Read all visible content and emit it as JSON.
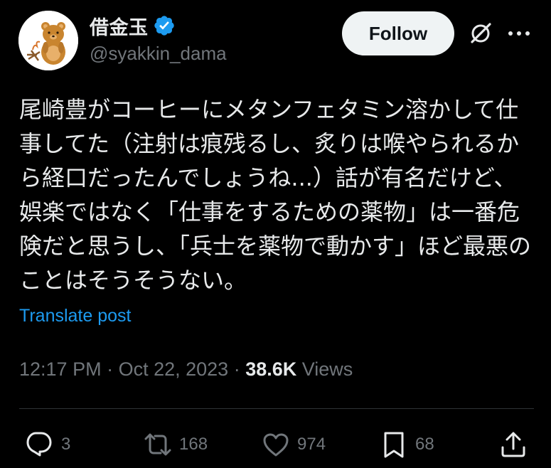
{
  "author": {
    "display_name": "借金玉",
    "handle": "@syakkin_dama",
    "verified": true,
    "avatar_icon": "bear-avatar-icon"
  },
  "header": {
    "follow_label": "Follow",
    "grok_icon": "grok-icon",
    "more_icon": "more-icon"
  },
  "tweet": {
    "text": "尾崎豊がコーヒーにメタンフェタミン溶かして仕事してた（注射は痕残るし、炙りは喉やられるから経口だったんでしょうね...）話が有名だけど、娯楽ではなく「仕事をするための薬物」は一番危険だと思うし、「兵士を薬物で動かす」ほど最悪のことはそうそうない。",
    "translate_label": "Translate post"
  },
  "meta": {
    "time": "12:17 PM",
    "separator": " · ",
    "date": "Oct 22, 2023",
    "views_count": "38.6K",
    "views_label": " Views"
  },
  "actions": {
    "reply_count": "3",
    "repost_count": "168",
    "like_count": "974",
    "bookmark_count": "68"
  },
  "colors": {
    "background": "#000000",
    "text_primary": "#e7e9ea",
    "text_secondary": "#71767b",
    "link": "#1d9bf0",
    "verified_badge": "#1d9bf0",
    "follow_button_bg": "#eff3f4",
    "divider": "#2f3336"
  }
}
